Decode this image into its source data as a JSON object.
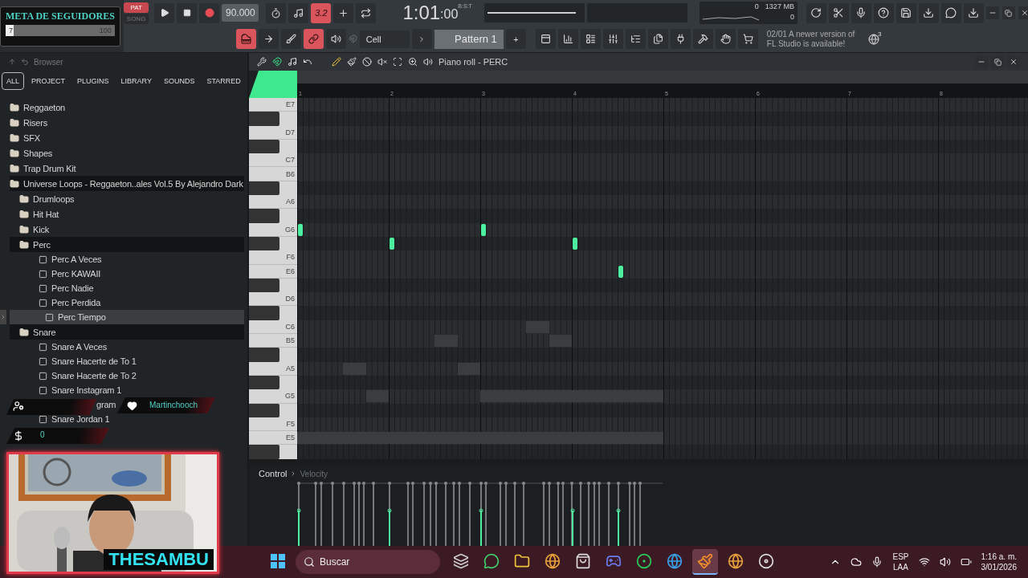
{
  "stream_overlay": {
    "goal_title": "META DE SEGUIDORES",
    "goal_current": "7",
    "goal_target": "100",
    "level": 0.07
  },
  "transport": {
    "modes": [
      {
        "label": "PAT",
        "selected": true
      },
      {
        "label": "SONG",
        "selected": false
      }
    ],
    "tempo": "90.000"
  },
  "top_buttons": [
    {
      "kind": "metronome",
      "on": false
    },
    {
      "kind": "wait",
      "on": false
    },
    {
      "kind": "step",
      "label": "3.2",
      "on": true
    },
    {
      "kind": "overdub",
      "on": false
    },
    {
      "kind": "loop",
      "on": false
    }
  ],
  "clock": {
    "time": "1:01",
    "ticks": ":00",
    "format": "B:S:T"
  },
  "monitor": {
    "cpu": "0",
    "memory": "1327 MB",
    "voices": "0"
  },
  "system_buttons": [
    {
      "kind": "undo"
    },
    {
      "kind": "cut"
    },
    {
      "kind": "mic"
    },
    {
      "kind": "help"
    },
    {
      "kind": "save"
    },
    {
      "kind": "render"
    },
    {
      "kind": "chat"
    },
    {
      "kind": "download"
    }
  ],
  "tools": [
    {
      "kind": "keys",
      "on": true
    },
    {
      "kind": "arrow",
      "on": false
    },
    {
      "kind": "paint",
      "on": false
    },
    {
      "kind": "link",
      "on": true
    },
    {
      "kind": "knob",
      "on": false
    }
  ],
  "snap": "Cell",
  "pattern": {
    "name": "Pattern 1",
    "add": "+"
  },
  "view_buttons": [
    {
      "kind": "playlist"
    },
    {
      "kind": "steps"
    },
    {
      "kind": "list"
    },
    {
      "kind": "mixer"
    },
    {
      "kind": "tree"
    },
    {
      "kind": "files"
    },
    {
      "kind": "plug"
    },
    {
      "kind": "hammer"
    },
    {
      "kind": "hand"
    },
    {
      "kind": "cart"
    }
  ],
  "notice": {
    "date": "02/01",
    "message": "A newer version of",
    "message_2": "FL Studio is available!",
    "count": "3"
  },
  "browser": {
    "title": "Browser",
    "tabs": [
      {
        "label": "ALL",
        "selected": true
      },
      {
        "label": "PROJECT",
        "selected": false
      },
      {
        "label": "PLUGINS",
        "selected": false
      },
      {
        "label": "LIBRARY",
        "selected": false
      },
      {
        "label": "SOUNDS",
        "selected": false
      },
      {
        "label": "STARRED",
        "selected": false
      }
    ],
    "tree": [
      {
        "label": "Reggaeton",
        "kind": "folder",
        "expanded": false,
        "selected": false
      },
      {
        "label": "Risers",
        "kind": "folder",
        "expanded": false,
        "selected": false
      },
      {
        "label": "SFX",
        "kind": "folder",
        "expanded": false,
        "selected": false
      },
      {
        "label": "Shapes",
        "kind": "folder",
        "expanded": false,
        "selected": false
      },
      {
        "label": "Trap Drum Kit",
        "kind": "folder",
        "expanded": false,
        "selected": false
      },
      {
        "label": "Universe Loops - Reggaeton..ales Vol.5 By Alejandro Dark",
        "kind": "folder",
        "expanded": true,
        "selected": false,
        "children": [
          {
            "label": "Drumloops",
            "kind": "folder",
            "expanded": false,
            "selected": false
          },
          {
            "label": "Hit Hat",
            "kind": "folder",
            "expanded": false,
            "selected": false
          },
          {
            "label": "Kick",
            "kind": "folder",
            "expanded": false,
            "selected": false
          },
          {
            "label": "Perc",
            "kind": "folder",
            "expanded": true,
            "selected": false,
            "children": [
              {
                "label": "Perc A Veces",
                "kind": "file",
                "selected": false
              },
              {
                "label": "Perc KAWAII",
                "kind": "file",
                "selected": false
              },
              {
                "label": "Perc Nadie",
                "kind": "file",
                "selected": false
              },
              {
                "label": "Perc Perdida",
                "kind": "file",
                "selected": false
              },
              {
                "label": "Perc Tiempo",
                "kind": "file",
                "selected": true
              }
            ]
          },
          {
            "label": "Snare",
            "kind": "folder",
            "expanded": true,
            "selected": false,
            "children": [
              {
                "label": "Snare A Veces",
                "kind": "file",
                "selected": false
              },
              {
                "label": "Snare Hacerte de To 1",
                "kind": "file",
                "selected": false
              },
              {
                "label": "Snare Hacerte de To 2",
                "kind": "file",
                "selected": false
              },
              {
                "label": "Snare Instagram 1",
                "kind": "file",
                "selected": false
              },
              {
                "label": "gram",
                "kind": "partial",
                "selected": false
              },
              {
                "label": "Snare Jordan 1",
                "kind": "file",
                "selected": false
              }
            ]
          }
        ]
      }
    ]
  },
  "piano_roll": {
    "title": "Piano roll - PERC",
    "bars": [
      "1",
      "2",
      "3",
      "4",
      "5",
      "6",
      "7",
      "8"
    ],
    "keys": [
      "E7",
      "D7",
      "C7",
      "B6",
      "A6",
      "G6",
      "F6",
      "E6",
      "D6",
      "C6",
      "B5",
      "A5",
      "G5",
      "F5",
      "E5"
    ],
    "control": "Control",
    "control_target": "Velocity"
  },
  "chat_overlay": {
    "follower": "Martinchooch",
    "donations": "0"
  },
  "webcam": {
    "kind": "picture",
    "name": "THESAMBU"
  },
  "taskbar": {
    "search": "Buscar",
    "apps": [
      {
        "kind": "stack",
        "selected": false
      },
      {
        "kind": "chat",
        "selected": false
      },
      {
        "kind": "folder",
        "selected": false
      },
      {
        "kind": "browser",
        "selected": false
      },
      {
        "kind": "bag",
        "selected": false
      },
      {
        "kind": "gamepad",
        "selected": false
      },
      {
        "kind": "green",
        "selected": false
      },
      {
        "kind": "wave",
        "selected": false
      },
      {
        "kind": "fruit",
        "selected": true
      },
      {
        "kind": "browser",
        "selected": false
      },
      {
        "kind": "disc",
        "selected": false
      }
    ],
    "language": "ESP",
    "layout": "LAA",
    "time": "1:16 a. m.",
    "date": "3/01/2026"
  }
}
